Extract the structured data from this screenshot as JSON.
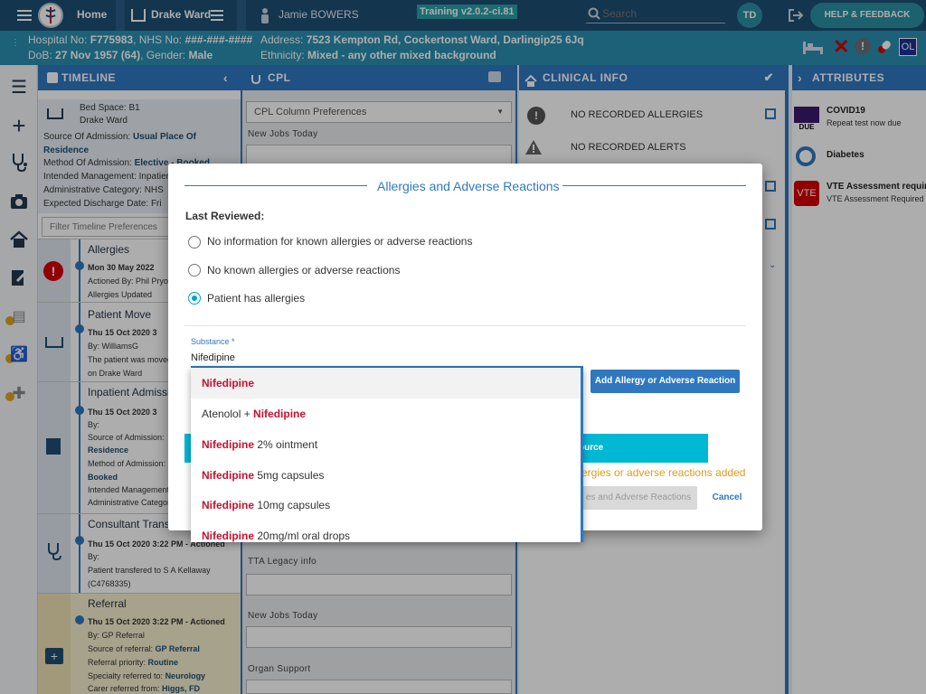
{
  "topbar": {
    "home": "Home",
    "ward": "Drake Ward",
    "patient": "Jamie BOWERS",
    "version": "Training v2.0.2-ci.81",
    "search_placeholder": "Search",
    "initials": "TD",
    "help": "HELP & FEEDBACK"
  },
  "patient_banner": {
    "hospital_no_label": "Hospital No:",
    "hospital_no": "F775983",
    "nhs_label": "NHS No:",
    "nhs": "###-###-####",
    "dob_label": "DoB:",
    "dob": "27 Nov 1957 (64)",
    "gender_label": "Gender:",
    "gender": "Male",
    "address_label": "Address:",
    "address": "7523 Kempton Rd, Cockertonst Ward, Darlingip25 6Jq",
    "ethnicity_label": "Ethnicity:",
    "ethnicity": "Mixed - any other mixed background",
    "ol": "OL"
  },
  "panels": {
    "timeline": "TIMELINE",
    "cpl": "CPL",
    "clinical": "CLINICAL INFO",
    "attributes": "ATTRIBUTES"
  },
  "timeline": {
    "bed_space": "Bed Space: B1",
    "ward": "Drake Ward",
    "src_label": "Source Of Admission:",
    "src": "Usual Place Of Residence",
    "method_label": "Method Of Admission:",
    "method": "Elective - Booked",
    "intended": "Intended Management: Inpatient",
    "admin": "Administrative Category: NHS",
    "discharge": "Expected Discharge Date: Fri",
    "filter_placeholder": "Filter Timeline Preferences",
    "entries": [
      {
        "title": "Allergies",
        "l1": "Mon 30 May 2022",
        "l2": "Actioned By: Phil Pryor",
        "l3": "Allergies Updated"
      },
      {
        "title": "Patient Move",
        "l1": "Thu 15 Oct 2020 3",
        "l2": "By: WilliamsG",
        "l3": "The patient was moved",
        "l4": "on Drake Ward"
      },
      {
        "title": "Inpatient Admission",
        "l1": "Thu 15 Oct 2020 3",
        "l2": "By:",
        "l3": "Source of Admission:",
        "l4": "Residence",
        "l5": "Method of Admission:",
        "l6": "Booked",
        "l7": "Intended Management",
        "l8": "Administrative Category"
      },
      {
        "title": "Consultant Transfer",
        "l1": "Thu 15 Oct 2020 3:22 PM - Actioned",
        "l2": "By:",
        "l3": "Patient transfered to S A Kellaway",
        "l4": "(C4768335)"
      },
      {
        "title": "Referral",
        "l1": "Thu 15 Oct 2020 3:22 PM - Actioned",
        "l2": "By: GP Referral",
        "l3_label": "Source of referral:",
        "l3": "GP Referral",
        "l4_label": "Referral priority:",
        "l4": "Routine",
        "l5_label": "Specialty referred to:",
        "l5": "Neurology",
        "l6_label": "Carer referred from:",
        "l6": "Higgs, FD"
      }
    ]
  },
  "cpl": {
    "prefs": "CPL Column Preferences",
    "new_jobs": "New Jobs Today",
    "tta": "TTA Legacy info",
    "new_jobs2": "New Jobs Today",
    "organ": "Organ Support"
  },
  "clinical": {
    "allergies": "NO RECORDED ALLERGIES",
    "alerts": "NO RECORDED ALERTS"
  },
  "attributes": [
    {
      "badge": "DUE",
      "title": "COVID19",
      "sub": "Repeat test now due"
    },
    {
      "badge": "",
      "title": "Diabetes",
      "sub": ""
    },
    {
      "badge": "VTE",
      "title": "VTE Assessment requir...",
      "sub": "VTE Assessment Required"
    }
  ],
  "modal": {
    "title": "Allergies and Adverse Reactions",
    "last_reviewed": "Last Reviewed:",
    "options": [
      "No information for known allergies or adverse reactions",
      "No known allergies or adverse reactions",
      "Patient has allergies"
    ],
    "selected_index": 2,
    "substance_label": "Substance *",
    "substance_value": "Nifedipine",
    "add_button": "Add Allergy or Adverse Reaction",
    "source_button": "ource",
    "warning": "ergies or adverse reactions added",
    "save_button": "es and Adverse Reactions",
    "cancel": "Cancel"
  },
  "dropdown": [
    {
      "prefix": "",
      "match": "Nifedipine",
      "suffix": ""
    },
    {
      "prefix": "Atenolol + ",
      "match": "Nifedipine",
      "suffix": ""
    },
    {
      "prefix": "",
      "match": "Nifedipine",
      "suffix": " 2% ointment"
    },
    {
      "prefix": "",
      "match": "Nifedipine",
      "suffix": " 5mg capsules"
    },
    {
      "prefix": "",
      "match": "Nifedipine",
      "suffix": " 10mg capsules"
    },
    {
      "prefix": "",
      "match": "Nifedipine",
      "suffix": " 20mg/ml oral drops"
    }
  ],
  "colors": {
    "accent": "#2f78c0",
    "brand_dark": "#1d4e74",
    "banner": "#2a8fb0",
    "match_red": "#c8102e",
    "teal": "#00b8d4",
    "warning": "#e09b1a"
  }
}
